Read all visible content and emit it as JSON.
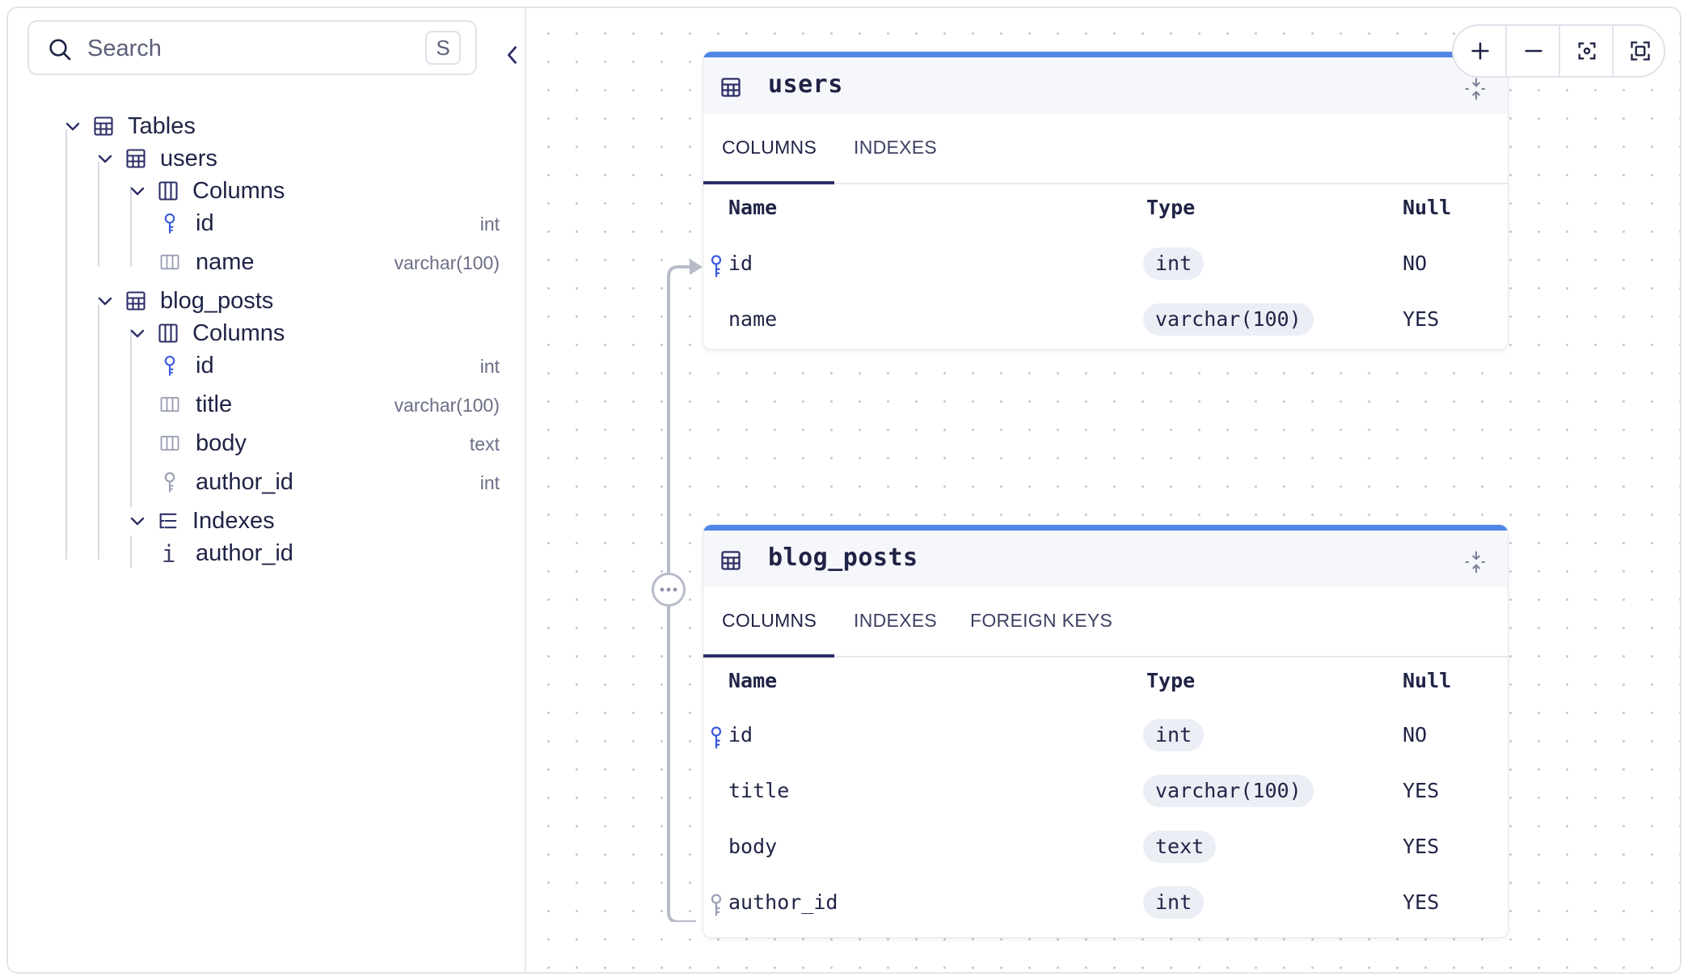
{
  "sidebar": {
    "search": {
      "placeholder": "Search",
      "shortcut": "S"
    },
    "tree": {
      "tables_label": "Tables",
      "users": {
        "label": "users",
        "columns_label": "Columns",
        "columns": [
          {
            "name": "id",
            "type": "int"
          },
          {
            "name": "name",
            "type": "varchar(100)"
          }
        ]
      },
      "blog_posts": {
        "label": "blog_posts",
        "columns_label": "Columns",
        "columns": [
          {
            "name": "id",
            "type": "int"
          },
          {
            "name": "title",
            "type": "varchar(100)"
          },
          {
            "name": "body",
            "type": "text"
          },
          {
            "name": "author_id",
            "type": "int"
          }
        ],
        "indexes_label": "Indexes",
        "indexes": [
          {
            "name": "author_id",
            "icon": "i"
          }
        ]
      }
    }
  },
  "canvas": {
    "users_card": {
      "title": "users",
      "tabs": [
        "COLUMNS",
        "INDEXES"
      ],
      "headers": {
        "name": "Name",
        "type": "Type",
        "null": "Null"
      },
      "rows": [
        {
          "name": "id",
          "type": "int",
          "null": "NO",
          "key": "primary"
        },
        {
          "name": "name",
          "type": "varchar(100)",
          "null": "YES",
          "key": "none"
        }
      ]
    },
    "blog_posts_card": {
      "title": "blog_posts",
      "tabs": [
        "COLUMNS",
        "INDEXES",
        "FOREIGN KEYS"
      ],
      "headers": {
        "name": "Name",
        "type": "Type",
        "null": "Null"
      },
      "rows": [
        {
          "name": "id",
          "type": "int",
          "null": "NO",
          "key": "primary"
        },
        {
          "name": "title",
          "type": "varchar(100)",
          "null": "YES",
          "key": "none"
        },
        {
          "name": "body",
          "type": "text",
          "null": "YES",
          "key": "none"
        },
        {
          "name": "author_id",
          "type": "int",
          "null": "YES",
          "key": "foreign"
        }
      ]
    }
  },
  "colors": {
    "accent": "#4f86e8",
    "primary_key": "#3b5bdb",
    "foreign_key": "#9aa0b4",
    "text": "#1f2345",
    "muted": "#6a6e86",
    "connector": "#b7bcc9"
  }
}
